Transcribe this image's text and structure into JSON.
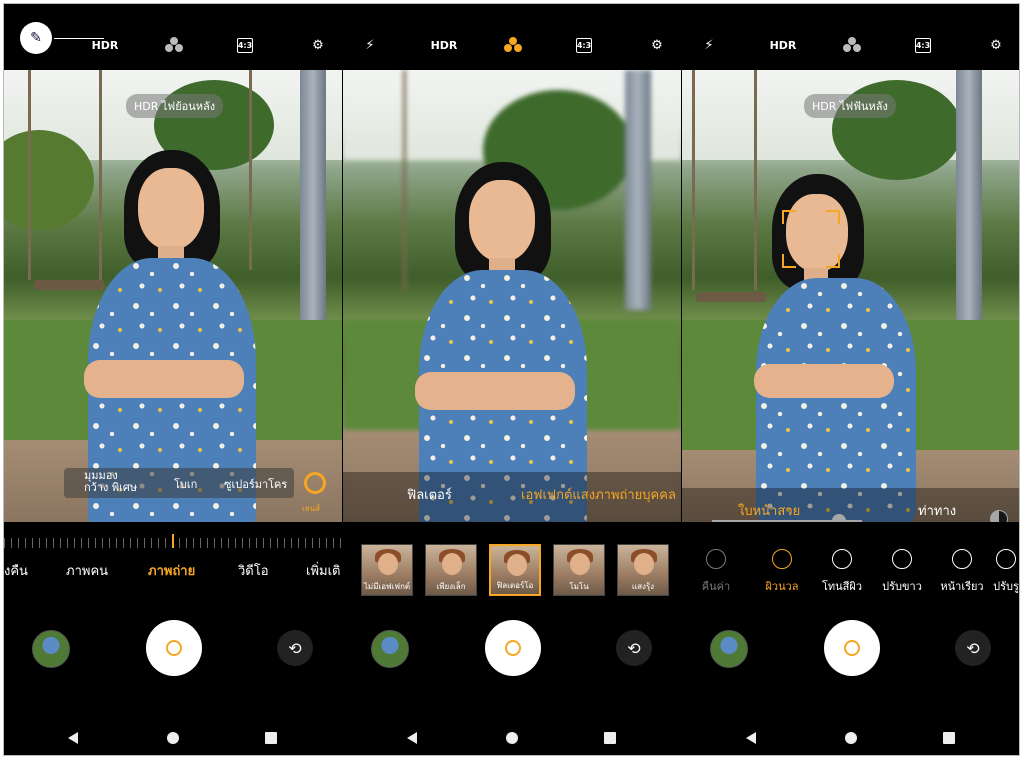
{
  "panel1": {
    "topbar": {
      "hdr": "HDR",
      "ratio": "4:3"
    },
    "hdr_chip": "HDR ไฟย้อนหลัง",
    "lens": {
      "wide": "มุมมองกว้าง พิเศษ",
      "bokeh": "โบเก",
      "macro": "ซูเปอร์มาโคร",
      "portrait": "เลนส์"
    },
    "modes": [
      "งคืน",
      "ภาพคน",
      "ภาพถ่าย",
      "วิดีโอ",
      "เพิ่มเติ"
    ],
    "active_mode": "ภาพถ่าย"
  },
  "panel2": {
    "topbar": {
      "hdr": "HDR",
      "ratio": "4:3"
    },
    "overlay": {
      "filter": "ฟิลเตอร์",
      "portrait_light": "เอฟเฟกต์แสงภาพถ่ายบุคคล"
    },
    "filters": [
      "ไม่มีเอฟเฟกต์",
      "เพียงเล็ก",
      "ฟิลเตอร์โอ",
      "โมโน",
      "แสงรุ้ง"
    ]
  },
  "panel3": {
    "topbar": {
      "hdr": "HDR",
      "ratio": "4:3"
    },
    "hdr_chip": "HDR ไฟฟันหลัง",
    "overlay": {
      "face": "ใบหน้าสวย",
      "pose": "ท่าทาง"
    },
    "beauty": [
      "คืนค่า",
      "ผิวนวล",
      "โทนสีผิว",
      "ปรับขาว",
      "หน้าเรียว",
      "ปรับรู"
    ]
  },
  "colors": {
    "accent": "#f5a623",
    "background": "#000000"
  }
}
